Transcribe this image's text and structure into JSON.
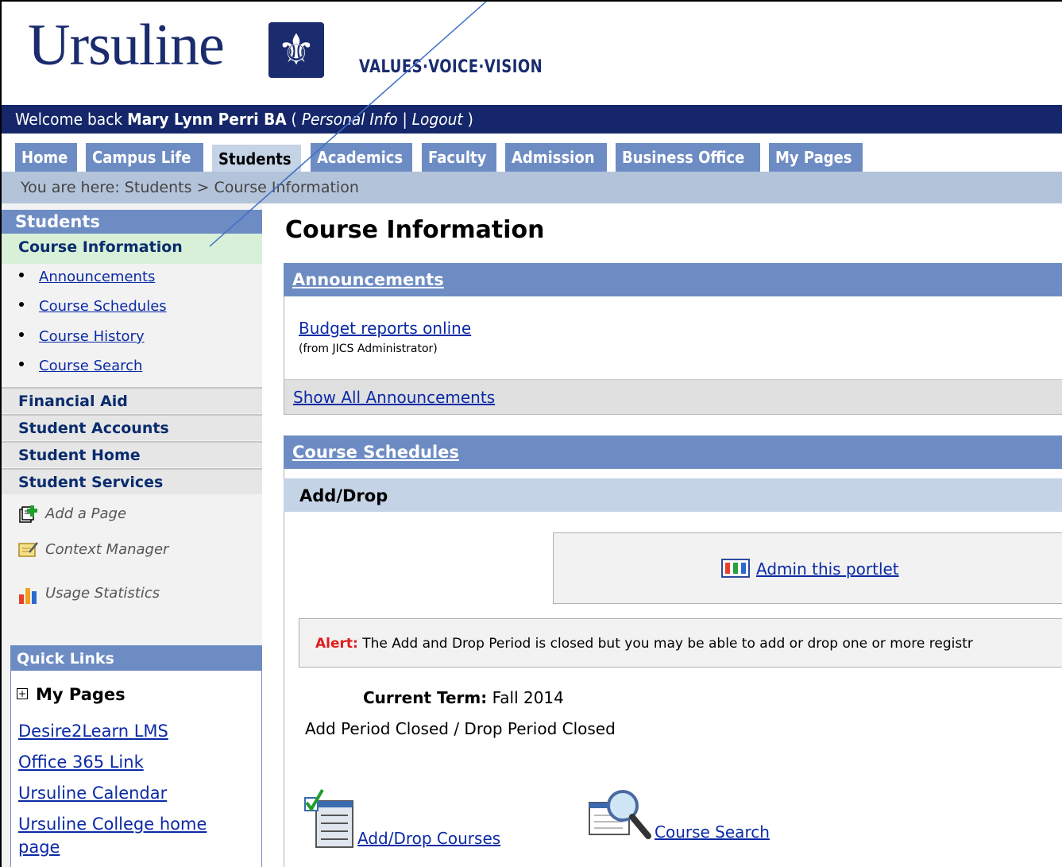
{
  "header": {
    "logo_text": "Ursuline",
    "tagline": "VALUES·VOICE·VISION",
    "welcome_prefix": "Welcome back ",
    "user_name": "Mary Lynn Perri BA",
    "paren_open": " ( ",
    "personal_info": "Personal Info",
    "separator": " | ",
    "logout": "Logout",
    "paren_close": " )"
  },
  "tabs": [
    {
      "label": "Home",
      "active": false
    },
    {
      "label": "Campus Life",
      "active": false
    },
    {
      "label": "Students",
      "active": true
    },
    {
      "label": "Academics",
      "active": false
    },
    {
      "label": "Faculty",
      "active": false
    },
    {
      "label": "Admission",
      "active": false
    },
    {
      "label": "Business Office",
      "active": false
    },
    {
      "label": "My Pages",
      "active": false
    }
  ],
  "breadcrumb": "You are here:  Students > Course Information",
  "sidebar": {
    "title": "Students",
    "current": "Course Information",
    "links": [
      "Announcements",
      "Course Schedules",
      "Course History",
      "Course Search"
    ],
    "sections": [
      "Financial Aid",
      "Student Accounts",
      "Student Home",
      "Student Services"
    ],
    "tools": [
      {
        "label": "Add a Page",
        "icon": "add-page-icon"
      },
      {
        "label": "Context Manager",
        "icon": "context-manager-icon"
      },
      {
        "label": "Usage Statistics",
        "icon": "usage-statistics-icon"
      }
    ],
    "quick_links": {
      "title": "Quick Links",
      "my_pages": "My Pages",
      "links": [
        "Desire2Learn LMS",
        "Office 365 Link",
        "Ursuline Calendar",
        "Ursuline College home",
        "page"
      ]
    }
  },
  "main": {
    "title": "Course Information",
    "announcements": {
      "heading": "Announcements",
      "item_title": "Budget reports online",
      "item_from": "(from JICS Administrator)",
      "show_all": "Show All Announcements"
    },
    "course_schedules": {
      "heading": "Course Schedules",
      "subheading": "Add/Drop",
      "admin_link": "Admin this portlet",
      "alert_label": "Alert:",
      "alert_text": " The Add and Drop Period is closed but you may be able to add or drop one or more registr",
      "term_label": "Current Term:",
      "term_value": " Fall 2014",
      "period_status": "Add Period Closed / Drop Period Closed",
      "add_drop_link": "Add/Drop Courses",
      "course_search_link": "Course Search"
    }
  },
  "colors": {
    "navy": "#15276a",
    "tab_blue": "#6e8cc4",
    "light_blue": "#c5d3e6",
    "alert_red": "#e01b1b"
  }
}
